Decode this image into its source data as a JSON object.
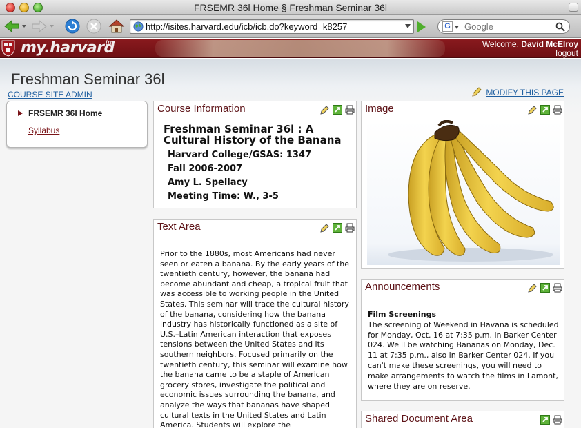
{
  "window": {
    "title": "FRSEMR 36l Home § Freshman Seminar 36l"
  },
  "browser": {
    "url": "http://isites.harvard.edu/icb/icb.do?keyword=k8257",
    "search_placeholder": "Google"
  },
  "header": {
    "brand": "my.harvard",
    "brand_tm": "tm",
    "welcome_prefix": "Welcome,",
    "user": "David McElroy",
    "logout": "logout"
  },
  "page": {
    "title": "Freshman Seminar 36l",
    "site_admin": "COURSE SITE ADMIN",
    "modify": "MODIFY THIS PAGE"
  },
  "nav": {
    "home": "FRSEMR 36l Home",
    "syllabus": "Syllabus"
  },
  "course_info": {
    "heading": "Course Information",
    "title": "Freshman Seminar 36l : A Cultural History of the Banana",
    "lines": [
      "Harvard College/GSAS: 1347",
      "Fall 2006-2007",
      "Amy L. Spellacy",
      "Meeting Time: W., 3-5"
    ]
  },
  "text_area": {
    "heading": "Text Area",
    "body": "Prior to the 1880s, most Americans had never seen or eaten a banana. By the early years of the twentieth century, however, the banana had become abundant and cheap, a tropical fruit that was accessible to working people in the United States. This seminar will trace the cultural history of the banana, considering how the banana industry has historically functioned as a site of U.S.–Latin American interaction that exposes tensions between the United States and its southern neighbors. Focused primarily on the twentieth century, this seminar will examine how the banana came to be a staple of American grocery stores, investigate the political and economic issues surrounding the banana, and analyze the ways that bananas have shaped cultural texts in the United States and Latin America. Students will explore the"
  },
  "image_box": {
    "heading": "Image"
  },
  "announcements": {
    "heading": "Announcements",
    "item_title": "Film Screenings",
    "item_body": "The screening of Weekend in Havana is scheduled for Monday, Oct. 16 at 7:35 p.m. in Barker Center 024. We'll be watching Bananas on Monday, Dec. 11 at 7:35 p.m., also in Barker Center 024. If you can't make these screenings, you will need to make arrangements to watch the films in Lamont, where they are on reserve."
  },
  "shared_docs": {
    "heading": "Shared Document Area"
  },
  "colors": {
    "crimson": "#7a1418",
    "link_blue": "#1f5fa0",
    "portlet_title": "#5e1418"
  }
}
